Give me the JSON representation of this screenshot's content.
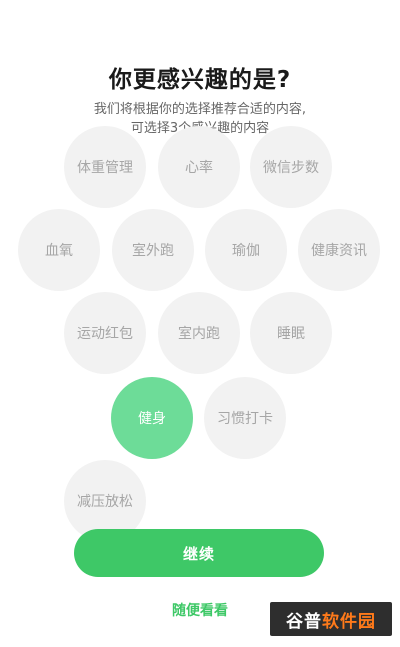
{
  "header": {
    "title": "你更感兴趣的是?",
    "subtitle_line1": "我们将根据你的选择推荐合适的内容,",
    "subtitle_line2": "可选择3个感兴趣的内容"
  },
  "interests": [
    {
      "label": "体重管理",
      "selected": false
    },
    {
      "label": "心率",
      "selected": false
    },
    {
      "label": "微信步数",
      "selected": false
    },
    {
      "label": "血氧",
      "selected": false
    },
    {
      "label": "室外跑",
      "selected": false
    },
    {
      "label": "瑜伽",
      "selected": false
    },
    {
      "label": "健康资讯",
      "selected": false
    },
    {
      "label": "运动红包",
      "selected": false
    },
    {
      "label": "室内跑",
      "selected": false
    },
    {
      "label": "睡眠",
      "selected": false
    },
    {
      "label": "健身",
      "selected": true
    },
    {
      "label": "习惯打卡",
      "selected": false
    },
    {
      "label": "减压放松",
      "selected": false
    }
  ],
  "actions": {
    "continue_label": "继续",
    "skip_label": "随便看看"
  },
  "watermark": {
    "part_a": "谷普",
    "part_b": "软件园"
  },
  "colors": {
    "accent": "#3ec867",
    "selected_bubble": "#6ddc98",
    "bubble": "#f2f2f2"
  }
}
